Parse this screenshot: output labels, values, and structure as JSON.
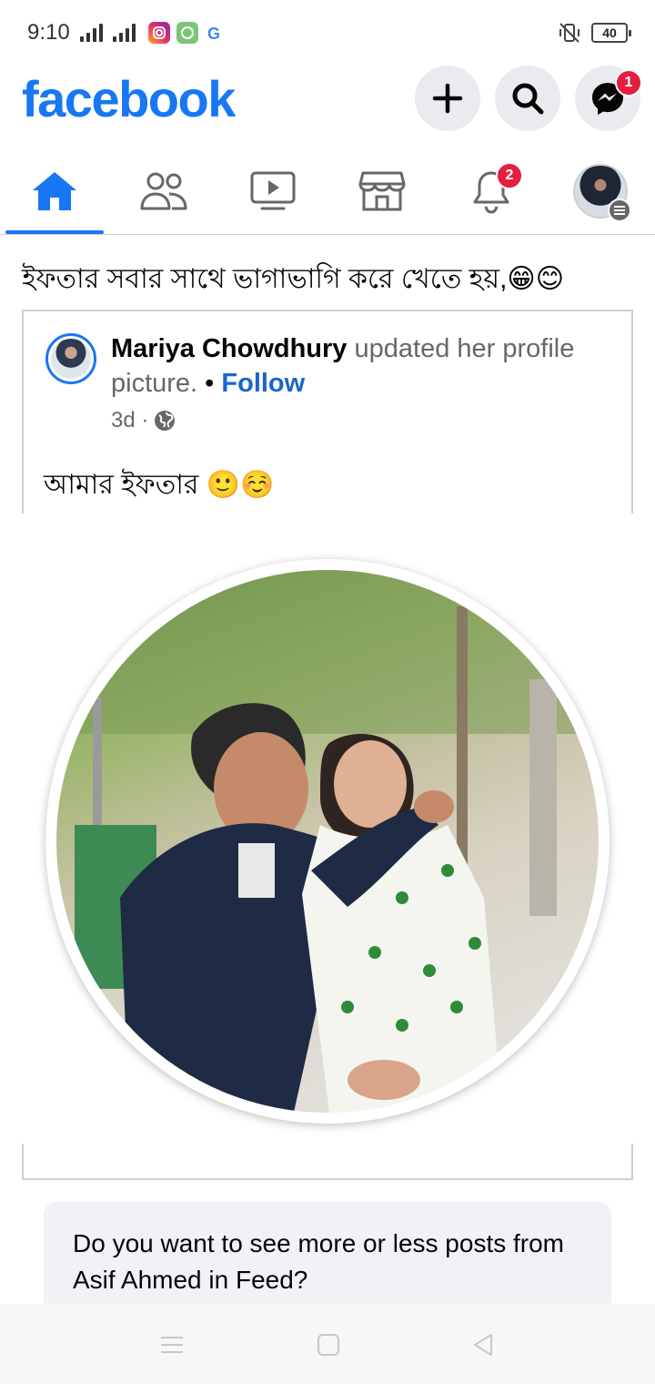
{
  "status_bar": {
    "time": "9:10",
    "battery": "40"
  },
  "header": {
    "logo": "facebook",
    "messenger_badge": "1"
  },
  "tabs": {
    "notifications_badge": "2"
  },
  "post": {
    "caption": "ইফতার সবার সাথে ভাগাভাগি করে খেতে হয়,😁😊"
  },
  "shared_post": {
    "author": "Mariya Chowdhury",
    "action": " updated her profile picture.",
    "separator": " • ",
    "follow_label": "Follow",
    "time": "3d ·",
    "text": "আমার ইফতার 🙂☺️"
  },
  "feedback": {
    "question": "Do you want to see more or less posts from Asif Ahmed in Feed?"
  },
  "colors": {
    "brand": "#1877f2",
    "badge": "#e41e3f",
    "follow": "#1b66c9"
  }
}
